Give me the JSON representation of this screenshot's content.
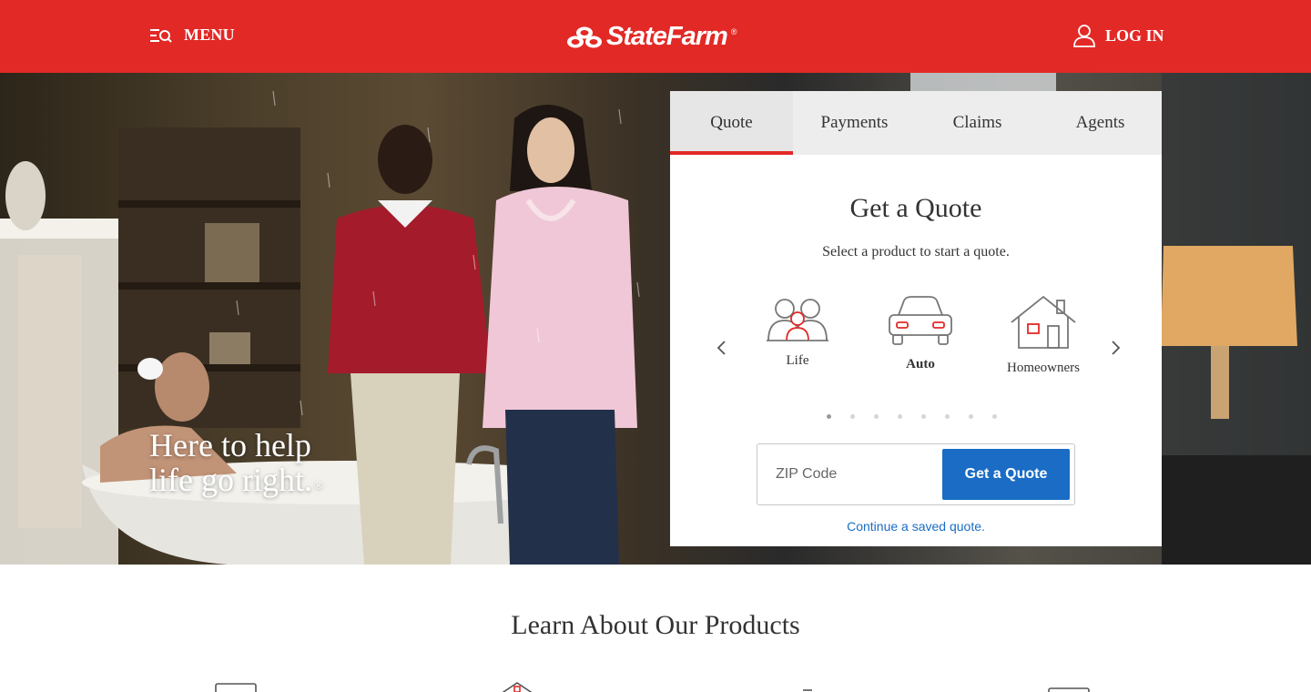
{
  "header": {
    "menu_label": "MENU",
    "logo_text": "StateFarm",
    "logo_reg": "®",
    "login_label": "LOG IN"
  },
  "hero": {
    "tagline_line1": "Here to help",
    "tagline_line2": "life go right.",
    "tagline_reg": "®"
  },
  "widget": {
    "tabs": [
      {
        "label": "Quote",
        "active": true
      },
      {
        "label": "Payments",
        "active": false
      },
      {
        "label": "Claims",
        "active": false
      },
      {
        "label": "Agents",
        "active": false
      }
    ],
    "title": "Get a Quote",
    "subtitle": "Select a product to start a quote.",
    "products": [
      {
        "label": "Life",
        "icon": "people-icon",
        "selected": false
      },
      {
        "label": "Auto",
        "icon": "car-icon",
        "selected": true
      },
      {
        "label": "Homeowners",
        "icon": "house-icon",
        "selected": false
      }
    ],
    "carousel_pages": 8,
    "carousel_active": 1,
    "zip_placeholder": "ZIP Code",
    "zip_value": "",
    "quote_button": "Get a Quote",
    "saved_quote_link": "Continue a saved quote."
  },
  "products_section": {
    "title": "Learn About Our Products"
  },
  "colors": {
    "brand_red": "#e22926",
    "link_blue": "#1a6cc4",
    "text_dark": "#333333"
  }
}
